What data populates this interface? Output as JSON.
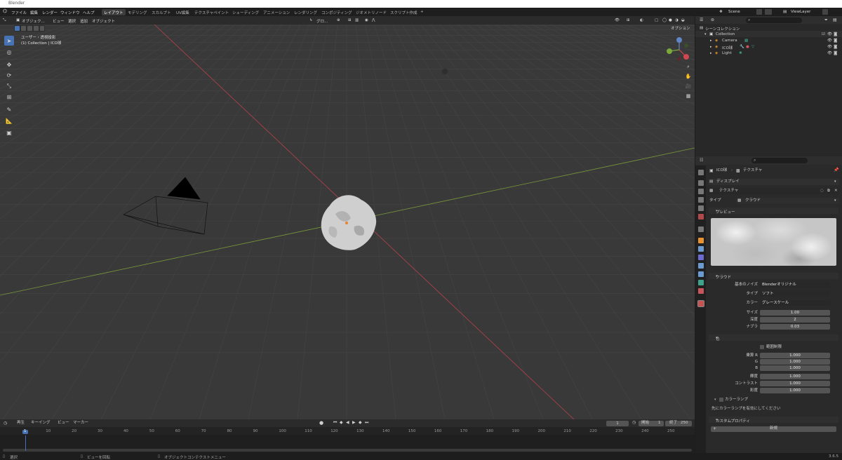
{
  "titlebar": {
    "title": "Blender"
  },
  "menu": [
    "ファイル",
    "編集",
    "レンダー",
    "ウィンドウ",
    "ヘルプ"
  ],
  "workspaces": [
    "レイアウト",
    "モデリング",
    "スカルプト",
    "UV編集",
    "テクスチャペイント",
    "シェーディング",
    "アニメーション",
    "レンダリング",
    "コンポジティング",
    "ジオメトリノード",
    "スクリプト作成",
    "+"
  ],
  "scene": {
    "name": "Scene",
    "view_layer": "ViewLayer"
  },
  "viewport": {
    "mode": "オブジェク...",
    "menus": [
      "ビュー",
      "選択",
      "追加",
      "オブジェクト"
    ],
    "transform": "グロ...",
    "options": "オプション",
    "overlay_line1": "ユーザー・透視投影",
    "overlay_line2": "(1) Collection | ICO球",
    "axes": {
      "x": "X",
      "y": "Y",
      "z": "Z"
    }
  },
  "outliner": {
    "root": "シーンコレクション",
    "collection": "Collection",
    "items": [
      "Camera",
      "ICO球",
      "Light"
    ]
  },
  "properties": {
    "breadcrumb_object": "ICO球",
    "breadcrumb_tab": "テクスチャ",
    "display": "ディスプレイ",
    "texture_name": "テクスチャ",
    "type_label": "タイプ",
    "type_value": "クラウド",
    "preview_label": "プレビュー",
    "cloud_panel": "クラウド",
    "cloud_rows": [
      {
        "label": "基本のノイズ",
        "value": "Blenderオリジナル"
      },
      {
        "label": "タイプ",
        "value": "ソフト"
      },
      {
        "label": "カラー",
        "value": "グレースケール"
      },
      {
        "label": "サイズ",
        "value": "1.00"
      },
      {
        "label": "深度",
        "value": "2"
      },
      {
        "label": "ナブラ",
        "value": "0.03"
      }
    ],
    "color_panel": "色",
    "clamp_label": "範囲制限",
    "color_rows": [
      {
        "label": "乗算 R",
        "value": "1.000"
      },
      {
        "label": "G",
        "value": "1.000"
      },
      {
        "label": "B",
        "value": "1.000"
      },
      {
        "label": "輝度",
        "value": "1.000"
      },
      {
        "label": "コントラスト",
        "value": "1.000"
      },
      {
        "label": "彩度",
        "value": "1.000"
      }
    ],
    "color_ramp": "カラーランプ",
    "color_ramp_note": "先にカラーランプを有効にしてください",
    "custom_props": "カスタムプロパティ",
    "new_button": "新規"
  },
  "timeline": {
    "menus": [
      "再生",
      "キーイング",
      "ビュー",
      "マーカー"
    ],
    "current_frame": "1",
    "start_label": "開始",
    "start": "1",
    "end_label": "終了",
    "end": "250",
    "ticks": [
      "1",
      "10",
      "20",
      "30",
      "40",
      "50",
      "60",
      "70",
      "80",
      "90",
      "100",
      "110",
      "120",
      "130",
      "140",
      "150",
      "160",
      "170",
      "180",
      "190",
      "200",
      "210",
      "220",
      "230",
      "240",
      "250"
    ]
  },
  "statusbar": {
    "select": "選択",
    "rotate": "ビューを回転",
    "context": "オブジェクトコンテクストメニュー",
    "version": "3.6.5"
  },
  "colors": {
    "accent": "#4772b3",
    "x_axis": "#b5424b",
    "y_axis": "#7a9a3a"
  }
}
